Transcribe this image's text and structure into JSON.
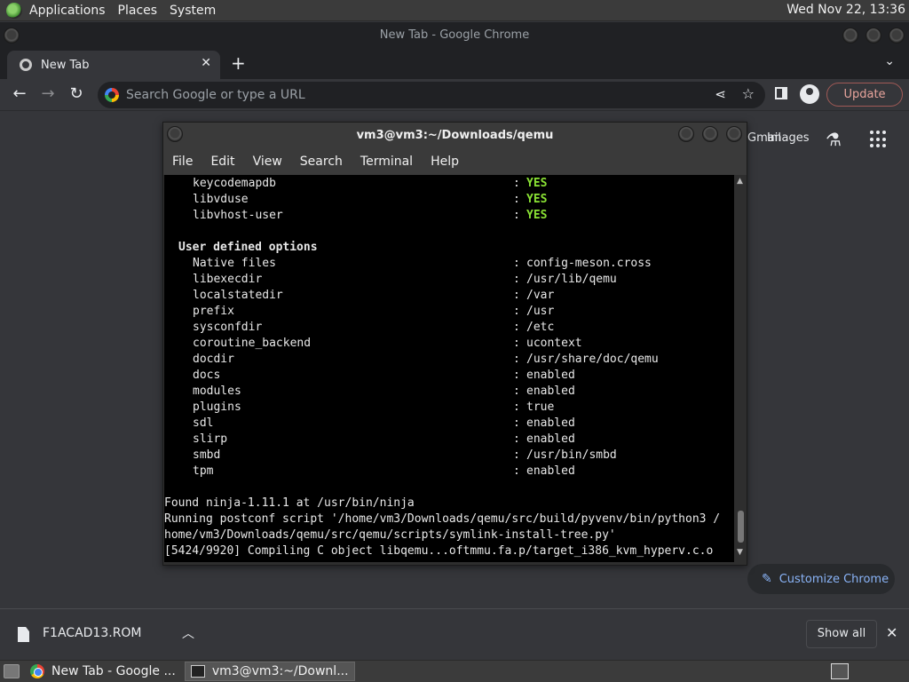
{
  "top_panel": {
    "menus": [
      "Applications",
      "Places",
      "System"
    ],
    "clock": "Wed Nov 22, 13:36"
  },
  "chrome": {
    "window_title": "New Tab - Google Chrome",
    "tab_title": "New Tab",
    "omnibox_placeholder": "Search Google or type a URL",
    "update_label": "Update",
    "ntp_gmail": "Gmail",
    "ntp_images": "Images",
    "customize_label": "Customize Chrome"
  },
  "download_bar": {
    "file_name": "F1ACAD13.ROM",
    "show_all_label": "Show all"
  },
  "terminal": {
    "title": "vm3@vm3:~/Downloads/qemu",
    "menus": [
      "File",
      "Edit",
      "View",
      "Search",
      "Terminal",
      "Help"
    ],
    "sep": ":",
    "yes_rows": [
      {
        "key": "keycodemapdb",
        "value": "YES"
      },
      {
        "key": "libvduse",
        "value": "YES"
      },
      {
        "key": "libvhost-user",
        "value": "YES"
      }
    ],
    "section_header": "User defined options",
    "options": [
      {
        "key": "Native files",
        "value": "config-meson.cross"
      },
      {
        "key": "libexecdir",
        "value": "/usr/lib/qemu"
      },
      {
        "key": "localstatedir",
        "value": "/var"
      },
      {
        "key": "prefix",
        "value": "/usr"
      },
      {
        "key": "sysconfdir",
        "value": "/etc"
      },
      {
        "key": "coroutine_backend",
        "value": "ucontext"
      },
      {
        "key": "docdir",
        "value": "/usr/share/doc/qemu"
      },
      {
        "key": "docs",
        "value": "enabled"
      },
      {
        "key": "modules",
        "value": "enabled"
      },
      {
        "key": "plugins",
        "value": "true"
      },
      {
        "key": "sdl",
        "value": "enabled"
      },
      {
        "key": "slirp",
        "value": "enabled"
      },
      {
        "key": "smbd",
        "value": "/usr/bin/smbd"
      },
      {
        "key": "tpm",
        "value": "enabled"
      }
    ],
    "tail_lines": [
      "Found ninja-1.11.1 at /usr/bin/ninja",
      "Running postconf script '/home/vm3/Downloads/qemu/src/build/pyvenv/bin/python3 /",
      "home/vm3/Downloads/qemu/src/qemu/scripts/symlink-install-tree.py'",
      "[5424/9920] Compiling C object libqemu...oftmmu.fa.p/target_i386_kvm_hyperv.c.o"
    ]
  },
  "taskbar": {
    "tasks": [
      "New Tab - Google ...",
      "vm3@vm3:~/Downl..."
    ]
  }
}
